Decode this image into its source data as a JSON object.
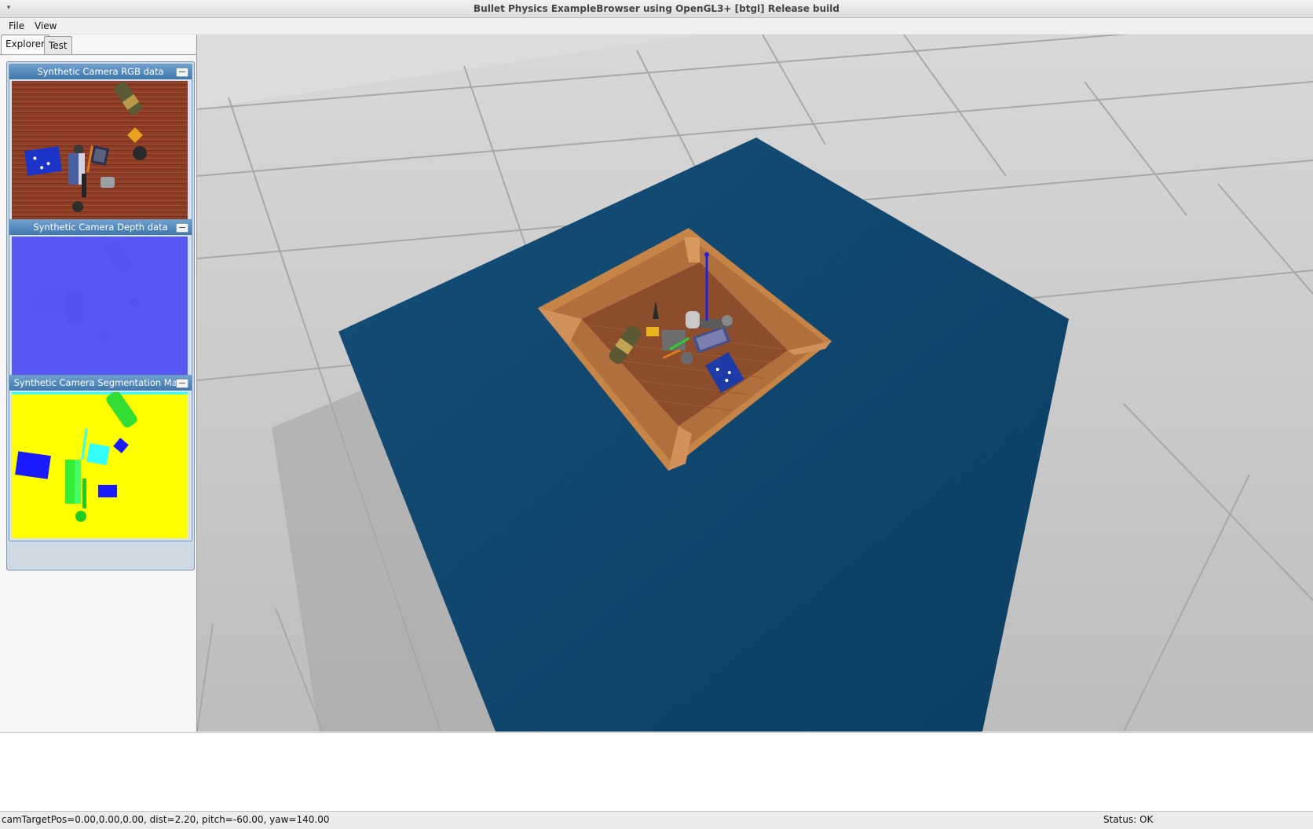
{
  "window": {
    "title": "Bullet Physics ExampleBrowser using OpenGL3+ [btgl] Release build",
    "menu_arrow": "▾"
  },
  "menubar": {
    "file_label": "File",
    "view_label": "View"
  },
  "tabs": [
    {
      "label": "Explorer",
      "active": true
    },
    {
      "label": "Test",
      "active": false
    }
  ],
  "camera_windows": [
    {
      "title": "Synthetic Camera RGB data"
    },
    {
      "title": "Synthetic Camera Depth data"
    },
    {
      "title": "Synthetic Camera Segmentation Mask"
    }
  ],
  "statusbar": {
    "camera_info": "camTargetPos=0.00,0.00,0.00, dist=2.20, pitch=-60.00, yaw=140.00",
    "status": "Status: OK"
  },
  "colors": {
    "floor": "#c8c8c8",
    "plane": "#0e4a74",
    "tray": "#c07f45",
    "tray_floor": "#8a4a2a",
    "depth": "#5c5cff",
    "mask_bg": "#ffff00",
    "mask_blue": "#1a1aff",
    "mask_green": "#33ff33",
    "mask_cyan": "#33ffff"
  }
}
